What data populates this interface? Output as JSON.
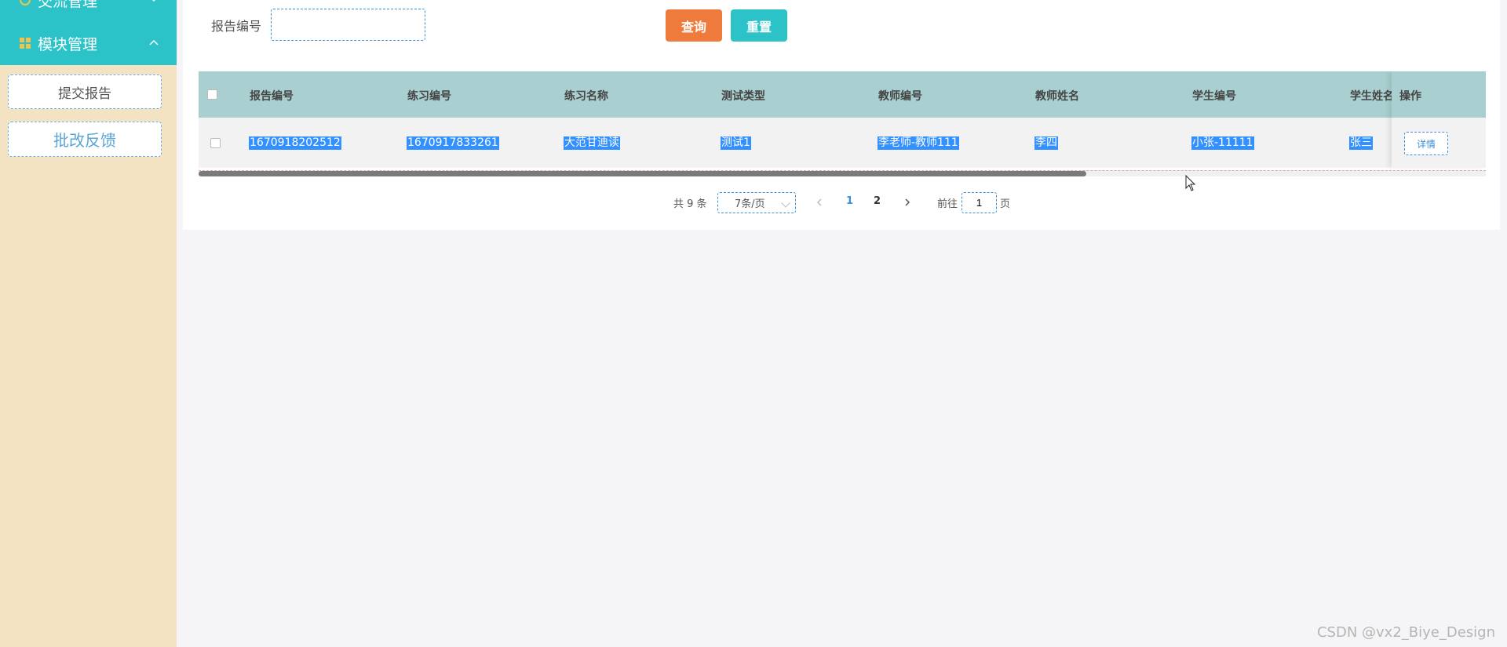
{
  "sidebar": {
    "menu_prev_label": "交流管理",
    "menu_label": "模块管理",
    "submit_report": "提交报告",
    "review_feedback": "批改反馈"
  },
  "search": {
    "label": "报告编号",
    "placeholder": "",
    "query_button": "查询",
    "reset_button": "重置"
  },
  "table": {
    "headers": [
      "报告编号",
      "练习编号",
      "练习名称",
      "测试类型",
      "教师编号",
      "教师姓名",
      "学生编号",
      "学生姓名",
      "操作"
    ],
    "rows": [
      [
        "1670918202512",
        "1670917833261",
        "大范甘迪读",
        "测试1",
        "李老师-教师111",
        "李四",
        "小张-11111",
        "张三"
      ]
    ],
    "action_label": "详情"
  },
  "pagination": {
    "total_text": "共 9 条",
    "page_size": "7条/页",
    "pages": [
      "1",
      "2"
    ],
    "current_page": "1",
    "goto_label": "前往",
    "goto_value": "1",
    "page_suffix": "页"
  },
  "watermark": "CSDN @vx2_Biye_Design",
  "colors": {
    "sidebar_bg": "#f3e3c3",
    "menu_teal": "#2bc3c7",
    "query_orange": "#ee7a3b",
    "header_bg": "#a9cfd0",
    "selection_blue": "#3390ff"
  }
}
